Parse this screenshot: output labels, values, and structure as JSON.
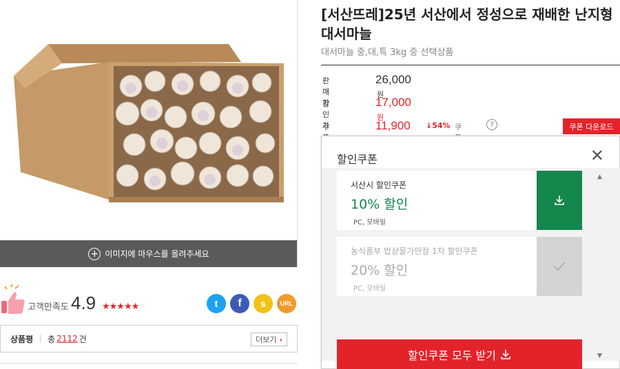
{
  "gallery": {
    "hover_hint": "이미지에 마우스를 올려주세요"
  },
  "satisfaction": {
    "label": "고객만족도",
    "score": "4.9",
    "stars": "★★★★★"
  },
  "share": {
    "twitter": "t",
    "facebook": "f",
    "kakaostory": "s",
    "url": "URL"
  },
  "reviews": {
    "label": "상품평",
    "total_prefix": "총",
    "count": "2112",
    "suffix": "건",
    "more": "더보기",
    "more_chevron": "›"
  },
  "product": {
    "title": "[서산뜨레]25년 서산에서 정성으로 재배한 난지형 대서마늘",
    "subtitle": "대서마늘 중,대,특 3kg 중 선택상품"
  },
  "prices": {
    "sale_label": "판매가",
    "sale_value": "26,000",
    "discount_label": "할인가",
    "discount_value": "17,000",
    "coupon_label": "쿠폰할인가",
    "coupon_value": "11,900",
    "unit": "원",
    "drop_rate": "↓54%",
    "coupon_guide": "쿠폰안내",
    "help": "?",
    "coupon_download": "쿠폰 다운로드"
  },
  "popup": {
    "title": "할인쿠폰",
    "close": "✕",
    "coupons": [
      {
        "name": "서산시 할인쿠폰",
        "amount": "10% 할인",
        "usage": "PC, 모바일",
        "action_icon": "download-icon"
      },
      {
        "name": "농식품부 밥상물가안정 1차 할인쿠폰",
        "amount": "20% 할인",
        "usage": "PC, 모바일",
        "action_icon": "check-icon"
      }
    ],
    "scroll_up": "▲",
    "scroll_down": "▼",
    "receive_all": "할인쿠폰 모두 받기"
  },
  "colors": {
    "accent_red": "#e3232a",
    "coupon_green": "#14874d",
    "twitter": "#1da1f2",
    "facebook": "#3b5bb5",
    "kakaostory": "#f2c21a",
    "url": "#f19a2c"
  }
}
